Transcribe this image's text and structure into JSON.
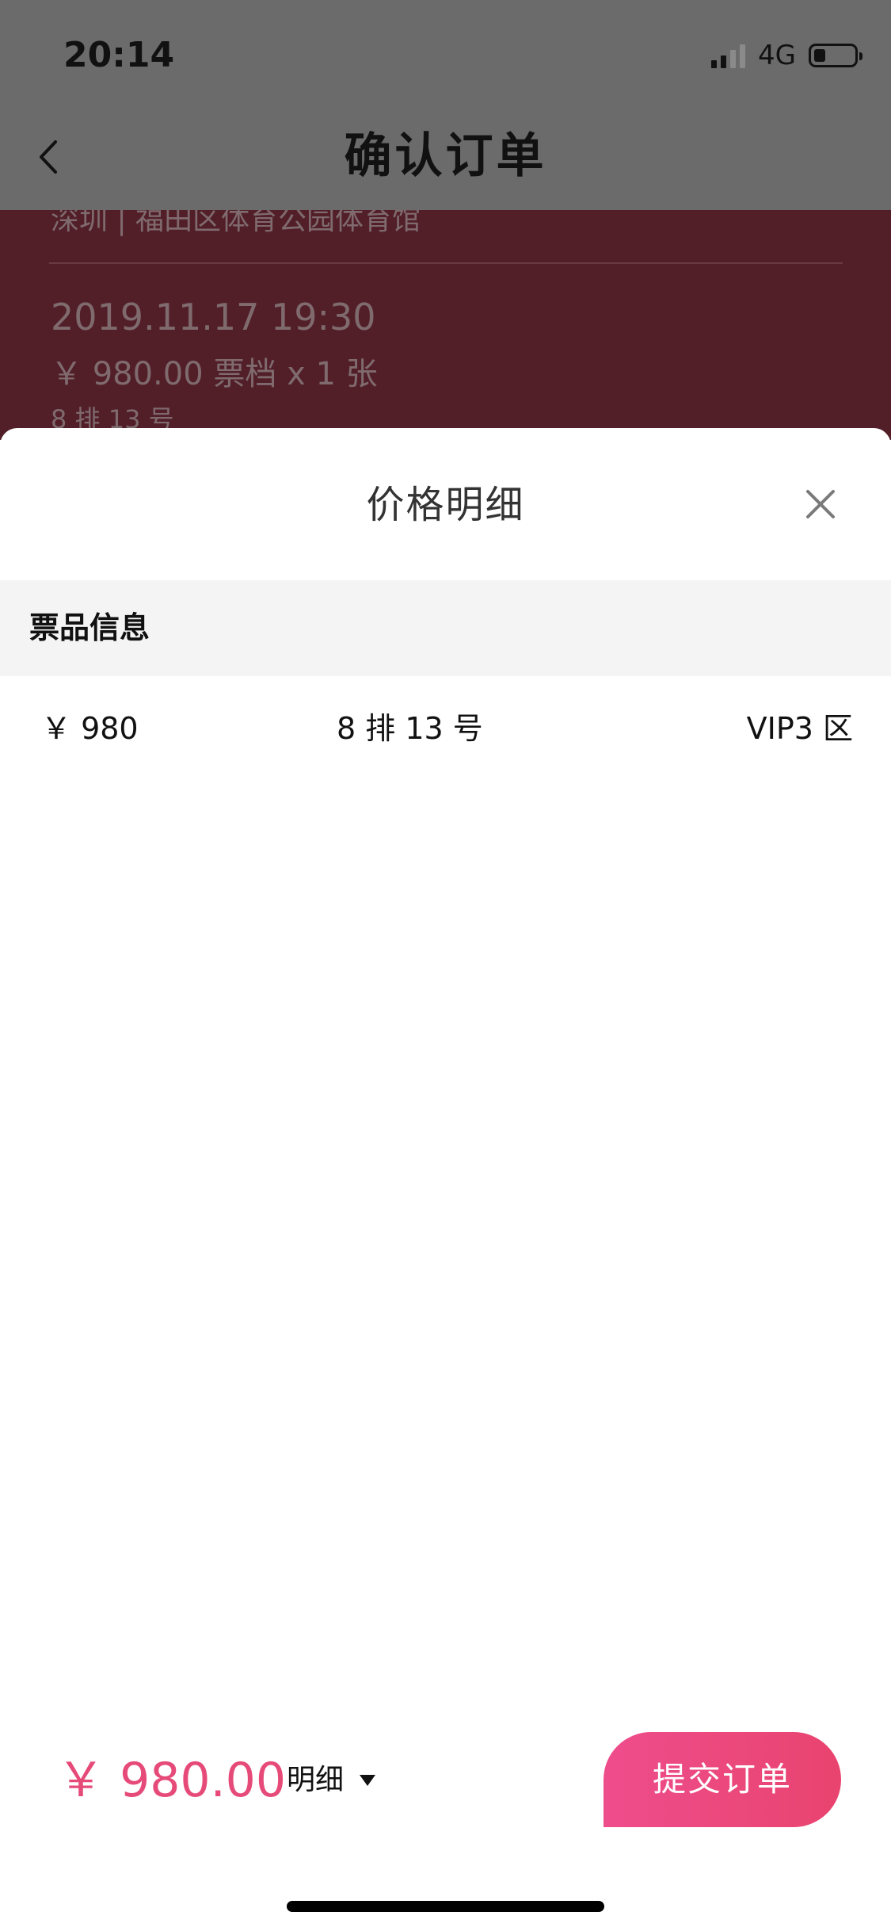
{
  "status_bar": {
    "time": "20:14",
    "network": "4G"
  },
  "nav": {
    "title": "确认订单",
    "back_icon": "chevron-left-icon"
  },
  "order_preview": {
    "venue": "深圳 | 福田区体育公园体育馆",
    "datetime": "2019.11.17 19:30",
    "price_line": "￥ 980.00 票档  x 1 张",
    "seat_line": "8 排 13 号"
  },
  "price_sheet": {
    "title": "价格明细",
    "close_icon": "close-icon",
    "section_label": "票品信息",
    "tickets": [
      {
        "price": "￥ 980",
        "seat": "8 排 13 号",
        "zone": "VIP3 区"
      }
    ]
  },
  "footer": {
    "total": "￥ 980.00",
    "detail_label": "明细",
    "submit_label": "提交订单"
  },
  "colors": {
    "accent": "#e64a79",
    "button_start": "#ee4d8c",
    "button_end": "#e9446f",
    "overlay_top": "#6b6b6b",
    "overlay_card": "#521f29",
    "section_bg": "#f4f4f4"
  }
}
